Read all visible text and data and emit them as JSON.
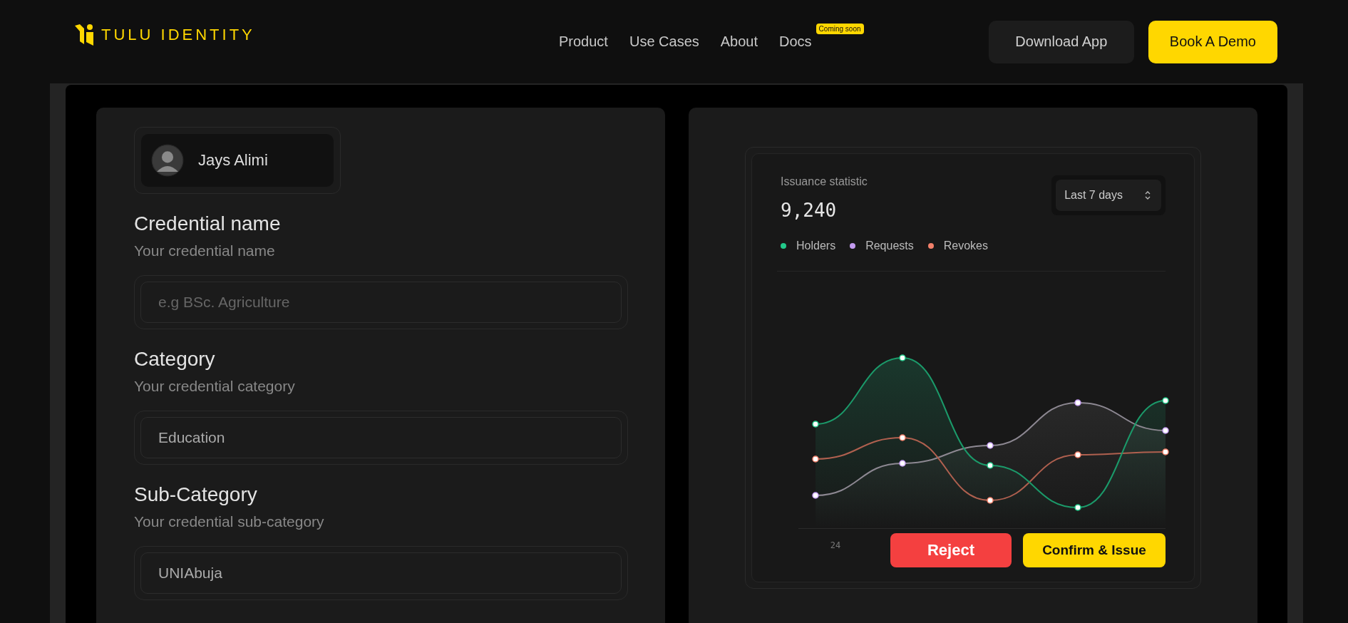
{
  "header": {
    "logo_text": "TULU IDENTITY",
    "nav": [
      {
        "label": "Product"
      },
      {
        "label": "Use Cases"
      },
      {
        "label": "About"
      },
      {
        "label": "Docs",
        "badge": "Coming soon"
      }
    ],
    "buttons": [
      {
        "label": "Download App",
        "kind": "secondary"
      },
      {
        "label": "Book A Demo",
        "kind": "primary"
      }
    ]
  },
  "form": {
    "user": {
      "name": "Jays Alimi"
    },
    "fields": [
      {
        "label": "Credential name",
        "hint": "Your credential name",
        "placeholder": "e.g BSc. Agriculture"
      },
      {
        "label": "Category",
        "hint": "Your credential category",
        "value": "Education"
      },
      {
        "label": "Sub-Category",
        "hint": "Your credential sub-category",
        "value": "UNIAbuja"
      }
    ]
  },
  "stats": {
    "title": "Issuance statistic",
    "total": "9,240",
    "range": "Last 7 days",
    "legend": [
      {
        "label": "Holders",
        "color": "#22c98a"
      },
      {
        "label": "Requests",
        "color": "#c39bf0"
      },
      {
        "label": "Revokes",
        "color": "#f2806a"
      }
    ],
    "x_label": "24",
    "actions": [
      {
        "label": "Reject",
        "kind": "danger"
      },
      {
        "label": "Confirm & Issue",
        "kind": "primary"
      }
    ]
  }
}
